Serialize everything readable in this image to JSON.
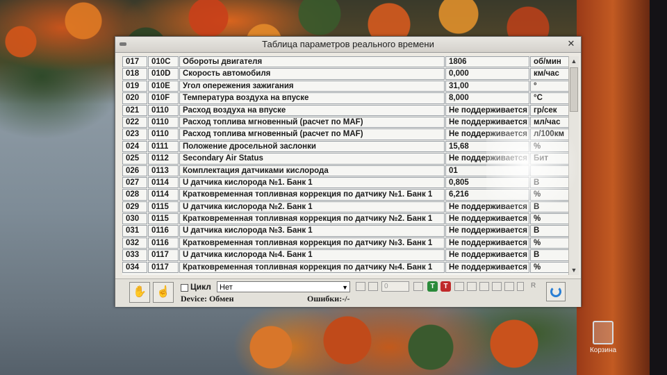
{
  "window": {
    "title": "Таблица параметров реального времени"
  },
  "table": {
    "rows": [
      {
        "num": "017",
        "pid": "010C",
        "name": "Обороты двигателя",
        "value": "1806",
        "unit": "об/мин"
      },
      {
        "num": "018",
        "pid": "010D",
        "name": "Скорость автомобиля",
        "value": "0,000",
        "unit": "км/час"
      },
      {
        "num": "019",
        "pid": "010E",
        "name": "Угол опережения зажигания",
        "value": "31,00",
        "unit": "°"
      },
      {
        "num": "020",
        "pid": "010F",
        "name": "Температура воздуха на впуске",
        "value": "8,000",
        "unit": "°C"
      },
      {
        "num": "021",
        "pid": "0110",
        "name": "Расход воздуха на впуске",
        "value": "Не поддерживается",
        "unit": "гр/сек"
      },
      {
        "num": "022",
        "pid": "0110",
        "name": "Расход топлива мгновенный (расчет по MAF)",
        "value": "Не поддерживается",
        "unit": "мл/час"
      },
      {
        "num": "023",
        "pid": "0110",
        "name": "Расход топлива мгновенный (расчет по MAF)",
        "value": "Не поддерживается",
        "unit": "л/100км"
      },
      {
        "num": "024",
        "pid": "0111",
        "name": "Положение дросельной заслонки",
        "value": "15,68",
        "unit": "%"
      },
      {
        "num": "025",
        "pid": "0112",
        "name": "Secondary Air Status",
        "value": "Не поддерживается",
        "unit": "Бит"
      },
      {
        "num": "026",
        "pid": "0113",
        "name": "Комплектация датчиками кислорода",
        "value": "01",
        "unit": ""
      },
      {
        "num": "027",
        "pid": "0114",
        "name": "U датчика кислорода №1. Банк 1",
        "value": "0,805",
        "unit": "В"
      },
      {
        "num": "028",
        "pid": "0114",
        "name": "Кратковременная топливная коррекция по датчику №1. Банк 1",
        "value": "6,216",
        "unit": "%"
      },
      {
        "num": "029",
        "pid": "0115",
        "name": "U датчика кислорода №2. Банк 1",
        "value": "Не поддерживается",
        "unit": "В"
      },
      {
        "num": "030",
        "pid": "0115",
        "name": "Кратковременная топливная коррекция по датчику №2. Банк 1",
        "value": "Не поддерживается",
        "unit": "%"
      },
      {
        "num": "031",
        "pid": "0116",
        "name": "U датчика кислорода №3. Банк 1",
        "value": "Не поддерживается",
        "unit": "В"
      },
      {
        "num": "032",
        "pid": "0116",
        "name": "Кратковременная топливная коррекция по датчику №3. Банк 1",
        "value": "Не поддерживается",
        "unit": "%"
      },
      {
        "num": "033",
        "pid": "0117",
        "name": "U датчика кислорода №4. Банк 1",
        "value": "Не поддерживается",
        "unit": "В"
      },
      {
        "num": "034",
        "pid": "0117",
        "name": "Кратковременная топливная коррекция по датчику №4. Банк 1",
        "value": "Не поддерживается",
        "unit": "%"
      }
    ]
  },
  "toolbar": {
    "cycle_label": "Цикл",
    "cycle_checked": false,
    "combo_value": "Нет",
    "counter_placeholder": "0",
    "t_green_label": "T",
    "t_red_label": "T",
    "r_label": "R",
    "device_text": "Device: Обмен",
    "errors_text": "Ошибки:-/-",
    "icons": [
      "hand-icon",
      "pointer-icon",
      "refresh-icon"
    ]
  },
  "desktop": {
    "trash_label": "Корзина"
  },
  "colors": {
    "t_green": "#2a8a3a",
    "t_red": "#c02a2a",
    "refresh": "#2a7fd4"
  }
}
